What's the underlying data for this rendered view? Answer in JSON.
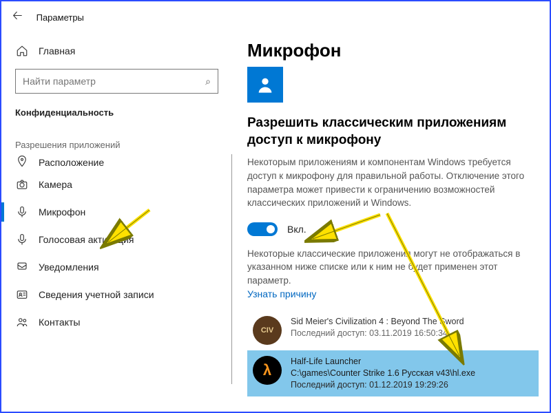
{
  "titlebar": {
    "title": "Параметры"
  },
  "search": {
    "placeholder": "Найти параметр"
  },
  "sidebar": {
    "section": "Конфиденциальность",
    "group": "Разрешения приложений",
    "items": [
      {
        "label": "Главная"
      },
      {
        "label": "Расположение"
      },
      {
        "label": "Камера"
      },
      {
        "label": "Микрофон"
      },
      {
        "label": "Голосовая активация"
      },
      {
        "label": "Уведомления"
      },
      {
        "label": "Сведения учетной записи"
      },
      {
        "label": "Контакты"
      }
    ]
  },
  "main": {
    "heading": "Микрофон",
    "subheading": "Разрешить классическим приложениям доступ к микрофону",
    "description": "Некоторым приложениям и компонентам Windows требуется доступ к микрофону для правильной работы. Отключение этого параметра может привести к ограничению возможностей классических приложений и Windows.",
    "toggle_label": "Вкл.",
    "note": "Некоторые классические приложения могут не отображаться в указанном ниже списке или к ним не будет применен этот параметр.",
    "learn_link": "Узнать причину",
    "apps": [
      {
        "name": "Sid Meier's Civilization 4 : Beyond The Sword",
        "sub": "Последний доступ: 03.11.2019 16:50:34"
      },
      {
        "name": "Half-Life Launcher",
        "path": "C:\\games\\Counter Strike 1.6 Русская v43\\hl.exe",
        "sub": "Последний доступ: 01.12.2019 19:29:26"
      }
    ]
  }
}
